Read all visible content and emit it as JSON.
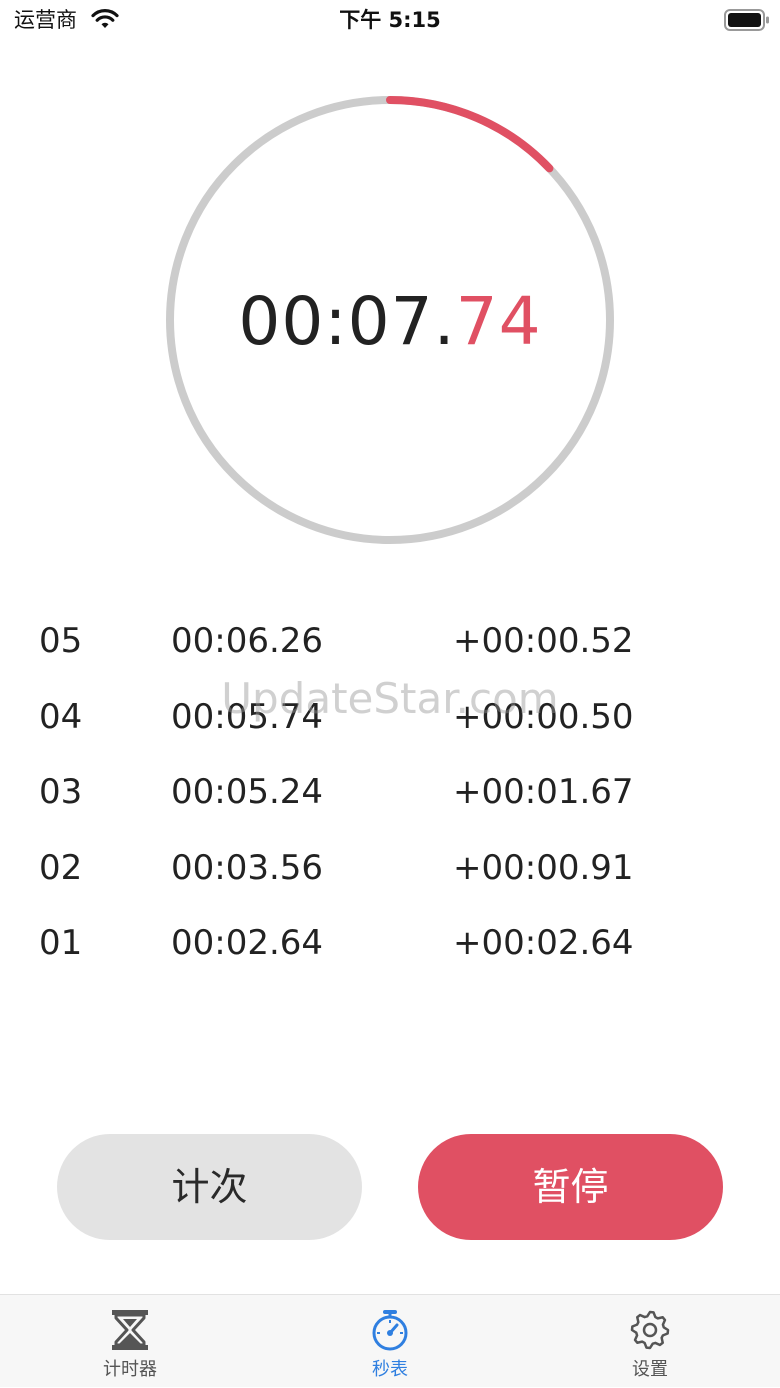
{
  "status_bar": {
    "carrier": "运营商",
    "time": "下午 5:15"
  },
  "stopwatch": {
    "time_main": "00:07.",
    "time_centiseconds": "74",
    "progress_fraction": 0.129
  },
  "laps": [
    {
      "num": "05",
      "total": "00:06.26",
      "split": "+00:00.52"
    },
    {
      "num": "04",
      "total": "00:05.74",
      "split": "+00:00.50"
    },
    {
      "num": "03",
      "total": "00:05.24",
      "split": "+00:01.67"
    },
    {
      "num": "02",
      "total": "00:03.56",
      "split": "+00:00.91"
    },
    {
      "num": "01",
      "total": "00:02.64",
      "split": "+00:02.64"
    }
  ],
  "watermark": "UpdateStar.com",
  "buttons": {
    "lap_label": "计次",
    "pause_label": "暂停"
  },
  "tabbar": {
    "items": [
      {
        "label": "计时器",
        "icon": "hourglass-icon",
        "active": false
      },
      {
        "label": "秒表",
        "icon": "stopwatch-icon",
        "active": true
      },
      {
        "label": "设置",
        "icon": "gear-icon",
        "active": false
      }
    ]
  },
  "colors": {
    "accent": "#e05063",
    "ring_track": "#cccccc",
    "tab_active": "#2f7fe0",
    "lap_button_bg": "#e3e3e3"
  }
}
